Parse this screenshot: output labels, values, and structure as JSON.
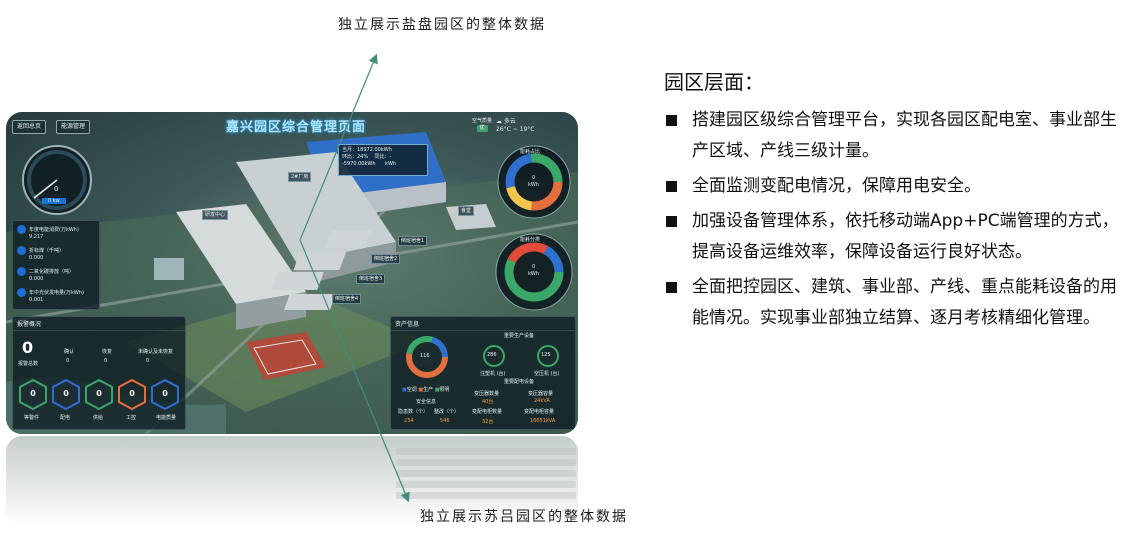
{
  "captions": {
    "top": "独立展示盐盘园区的整体数据",
    "bottom": "独立展示苏吕园区的整体数据"
  },
  "dashboard": {
    "buttons": [
      "返回总页",
      "能源管理"
    ],
    "title": "嘉兴园区综合管理页面",
    "air_quality": {
      "label": "空气质量",
      "value": "优"
    },
    "weather": {
      "condition": "多云",
      "temp": "26°C ~ 19°C"
    },
    "gauge": {
      "value": "0",
      "unit": "0 kw"
    },
    "metrics": [
      {
        "label": "年度电能消费(万kWh)",
        "value": "9.217"
      },
      {
        "label": "折标煤（千吨）",
        "value": "0.000"
      },
      {
        "label": "二氧化碳排放（吨）",
        "value": "0.000"
      },
      {
        "label": "年中光伏发电量(万kWh)",
        "value": "0.001"
      }
    ],
    "popup": {
      "line1": "当月：18972.00kWh",
      "line2": "环比：24%",
      "line3": "同比：-",
      "line4": "-5970.00kWh",
      "line5": "kWh"
    },
    "buildings": [
      "研发中心",
      "2#厂房",
      "食堂",
      "倒班宿舍1",
      "倒班宿舍2",
      "倒班宿舍3",
      "倒班宿舍4"
    ],
    "donut_right_top": {
      "title": "能耗占比",
      "center": "kWh",
      "value": "0"
    },
    "donut_right_bottom": {
      "title": "能耗分类",
      "center": "kWh",
      "value": "0"
    },
    "alarm": {
      "title": "报警概况",
      "total": "0",
      "total_label": "报警总数",
      "cols": [
        "确认",
        "恢复",
        "未确认及未恢复"
      ],
      "col_values": [
        "0",
        "0",
        "0"
      ],
      "types": [
        {
          "label": "等警件",
          "value": "0"
        },
        {
          "label": "配电",
          "value": "0"
        },
        {
          "label": "供给",
          "value": "0"
        },
        {
          "label": "工控",
          "value": "0"
        },
        {
          "label": "电能质量",
          "value": "0"
        }
      ]
    },
    "assets": {
      "title": "资产信息",
      "donut_center": "116",
      "legend": [
        "空调",
        "生产",
        "照明"
      ],
      "prod_title": "重要生产设备",
      "prod_a": {
        "value": "286",
        "label": "注塑机 (台)"
      },
      "prod_b": {
        "value": "125",
        "label": "空压机 (台)"
      },
      "sub_title": "安全信息",
      "sub_a": {
        "label": "隐患数（个）",
        "value": "234"
      },
      "sub_b": {
        "label": "整改（个）",
        "value": "546"
      },
      "sub2_title": "重要配电设备",
      "tr_a": {
        "label": "变压器数量",
        "value": "40台"
      },
      "tr_b": {
        "label": "变压器容量",
        "value": "24kVA"
      },
      "tr_c": {
        "label": "变配电柜数量",
        "value": "32台"
      },
      "tr_d": {
        "label": "变配电柜容量",
        "value": "16651kVA"
      }
    }
  },
  "right": {
    "heading": "园区层面：",
    "items": [
      "搭建园区级综合管理平台，实现各园区配电室、事业部生产区域、产线三级计量。",
      "全面监测变配电情况，保障用电安全。",
      "加强设备管理体系，依托移动端App+PC端管理的方式，提高设备运维效率，保障设备运行良好状态。",
      "全面把控园区、建筑、事业部、产线、重点能耗设备的用能情况。实现事业部独立结算、逐月考核精细化管理。"
    ]
  },
  "colors": {
    "arrow": "#3f8f7a",
    "title_glow": "#2aa8ff",
    "bullet": "#111111"
  }
}
